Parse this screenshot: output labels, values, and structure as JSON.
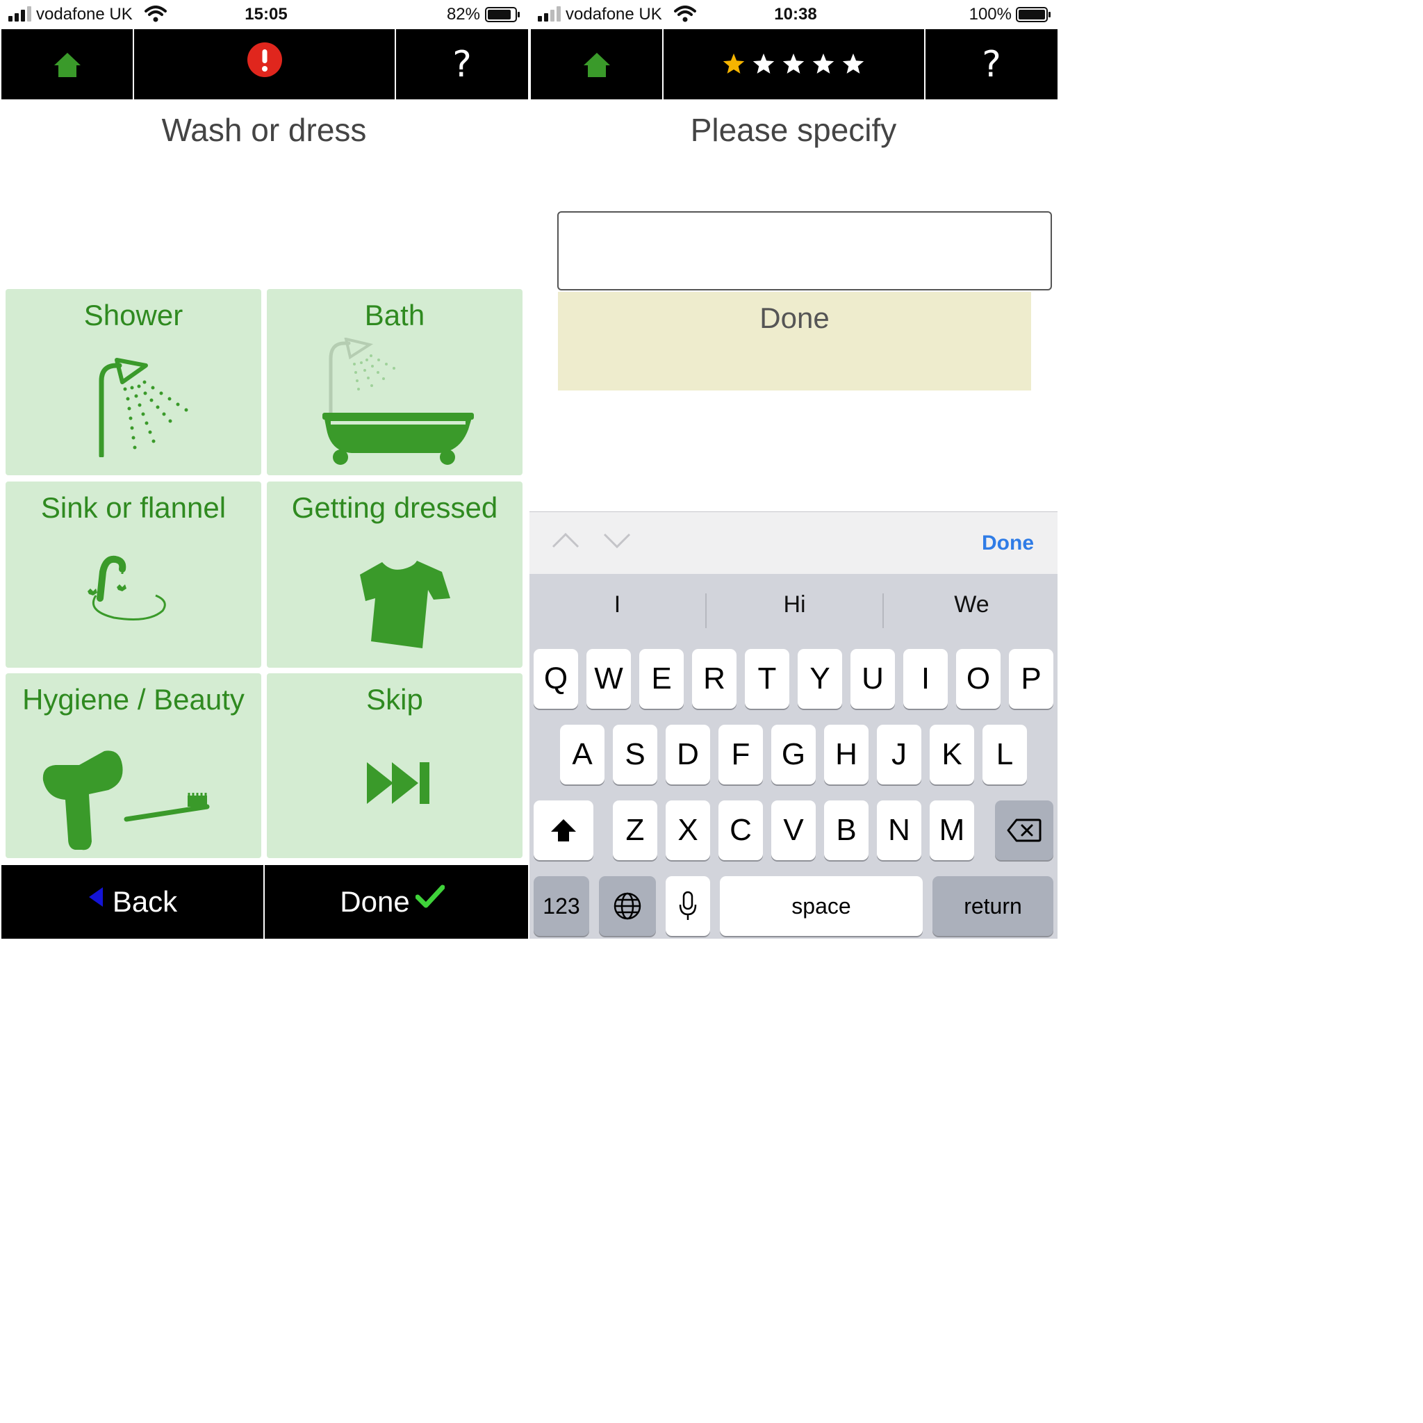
{
  "left_screen": {
    "status_bar": {
      "carrier": "vodafone UK",
      "time": "15:05",
      "battery": "82%"
    },
    "nav": {
      "home_icon": "home-icon",
      "alert_icon": "alert-icon",
      "help_label": "?"
    },
    "title": "Wash or dress",
    "tiles": [
      {
        "label": "Shower",
        "icon": "shower-icon"
      },
      {
        "label": "Bath",
        "icon": "bath-icon"
      },
      {
        "label": "Sink or flannel",
        "icon": "sink-icon"
      },
      {
        "label": "Getting dressed",
        "icon": "tshirt-icon"
      },
      {
        "label": "Hygiene / Beauty",
        "icon": "hairdryer-toothbrush-icon"
      },
      {
        "label": "Skip",
        "icon": "skip-icon"
      }
    ],
    "bottom": {
      "back_label": "Back",
      "done_label": "Done"
    }
  },
  "right_screen": {
    "status_bar": {
      "carrier": "vodafone UK",
      "time": "10:38",
      "battery": "100%"
    },
    "nav": {
      "home_icon": "home-icon",
      "rating_stars": 5,
      "rating_filled": 1,
      "help_label": "?"
    },
    "title": "Please specify",
    "input_value": "",
    "done_panel_label": "Done",
    "keyboard": {
      "accessory_done": "Done",
      "suggestions": [
        "I",
        "Hi",
        "We"
      ],
      "row1": [
        "Q",
        "W",
        "E",
        "R",
        "T",
        "Y",
        "U",
        "I",
        "O",
        "P"
      ],
      "row2": [
        "A",
        "S",
        "D",
        "F",
        "G",
        "H",
        "J",
        "K",
        "L"
      ],
      "row3": [
        "Z",
        "X",
        "C",
        "V",
        "B",
        "N",
        "M"
      ],
      "numbers_label": "123",
      "space_label": "space",
      "return_label": "return"
    }
  },
  "colors": {
    "tile_bg": "#d4ecd2",
    "tile_text": "#2f8a20",
    "icon_green": "#3a9a2a",
    "nav_bg": "#000000",
    "done_panel_bg": "#eeeccd",
    "alert_red": "#e0261d",
    "star_gold": "#f5b400",
    "link_blue": "#2f7ce6",
    "keyboard_bg": "#d2d4db"
  }
}
